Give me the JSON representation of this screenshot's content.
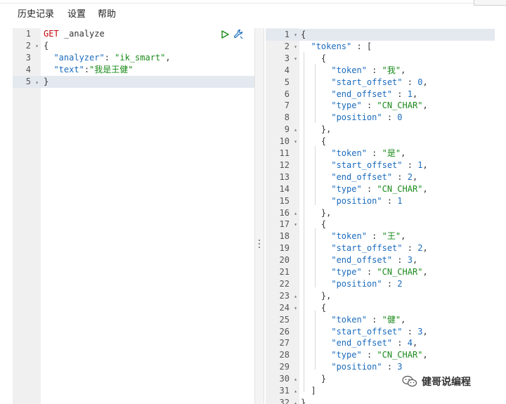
{
  "menu": {
    "history": "历史记录",
    "settings": "设置",
    "help": "帮助"
  },
  "request": {
    "lines": [
      {
        "n": "1",
        "fold": ""
      },
      {
        "n": "2",
        "fold": "▾"
      },
      {
        "n": "3",
        "fold": ""
      },
      {
        "n": "4",
        "fold": ""
      },
      {
        "n": "5",
        "fold": "▴"
      }
    ],
    "method": "GET",
    "endpoint": "_analyze",
    "open_brace": "{",
    "close_brace": "}",
    "analyzer_key": "\"analyzer\"",
    "analyzer_value": "\"ik_smart\"",
    "text_key": "\"text\"",
    "text_value": "\"我是王健\""
  },
  "response": {
    "lines": [
      {
        "n": "1",
        "fold": "▾"
      },
      {
        "n": "2",
        "fold": "▾"
      },
      {
        "n": "3",
        "fold": "▾"
      },
      {
        "n": "4",
        "fold": ""
      },
      {
        "n": "5",
        "fold": ""
      },
      {
        "n": "6",
        "fold": ""
      },
      {
        "n": "7",
        "fold": ""
      },
      {
        "n": "8",
        "fold": ""
      },
      {
        "n": "9",
        "fold": "▴"
      },
      {
        "n": "10",
        "fold": "▾"
      },
      {
        "n": "11",
        "fold": ""
      },
      {
        "n": "12",
        "fold": ""
      },
      {
        "n": "13",
        "fold": ""
      },
      {
        "n": "14",
        "fold": ""
      },
      {
        "n": "15",
        "fold": ""
      },
      {
        "n": "16",
        "fold": "▴"
      },
      {
        "n": "17",
        "fold": "▾"
      },
      {
        "n": "18",
        "fold": ""
      },
      {
        "n": "19",
        "fold": ""
      },
      {
        "n": "20",
        "fold": ""
      },
      {
        "n": "21",
        "fold": ""
      },
      {
        "n": "22",
        "fold": ""
      },
      {
        "n": "23",
        "fold": "▴"
      },
      {
        "n": "24",
        "fold": "▾"
      },
      {
        "n": "25",
        "fold": ""
      },
      {
        "n": "26",
        "fold": ""
      },
      {
        "n": "27",
        "fold": ""
      },
      {
        "n": "28",
        "fold": ""
      },
      {
        "n": "29",
        "fold": ""
      },
      {
        "n": "30",
        "fold": "▴"
      },
      {
        "n": "31",
        "fold": "▴"
      },
      {
        "n": "32",
        "fold": "▴"
      }
    ],
    "tokens_key": "\"tokens\"",
    "token_items": [
      {
        "token": "\"我\"",
        "start_offset": "0",
        "end_offset": "1",
        "type": "\"CN_CHAR\"",
        "position": "0"
      },
      {
        "token": "\"是\"",
        "start_offset": "1",
        "end_offset": "2",
        "type": "\"CN_CHAR\"",
        "position": "1"
      },
      {
        "token": "\"王\"",
        "start_offset": "2",
        "end_offset": "3",
        "type": "\"CN_CHAR\"",
        "position": "2"
      },
      {
        "token": "\"健\"",
        "start_offset": "3",
        "end_offset": "4",
        "type": "\"CN_CHAR\"",
        "position": "3"
      }
    ],
    "field_keys": {
      "token": "\"token\"",
      "start_offset": "\"start_offset\"",
      "end_offset": "\"end_offset\"",
      "type": "\"type\"",
      "position": "\"position\""
    }
  },
  "watermark": {
    "text": "健哥说编程"
  },
  "colors": {
    "keyword": "#c5060b",
    "string": "#1a8a1a",
    "key": "#1a6bbd",
    "gutter": "#f0f0f0",
    "active_line": "#e4e8ef",
    "accent": "#1a6bbd"
  }
}
